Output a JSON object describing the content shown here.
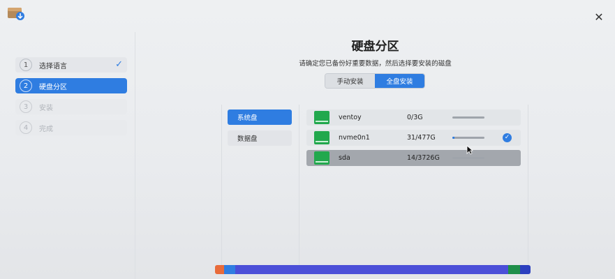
{
  "window": {
    "title": ""
  },
  "steps": [
    {
      "num": "1",
      "label": "选择语言",
      "state": "done"
    },
    {
      "num": "2",
      "label": "硬盘分区",
      "state": "active"
    },
    {
      "num": "3",
      "label": "安装",
      "state": "todo"
    },
    {
      "num": "4",
      "label": "完成",
      "state": "todo"
    }
  ],
  "main": {
    "title": "硬盘分区",
    "subtitle": "请确定您已备份好重要数据，然后选择要安装的磁盘",
    "mode_manual": "手动安装",
    "mode_full": "全盘安装",
    "selected_mode": "全盘安装"
  },
  "tabs": [
    {
      "label": "系统盘",
      "selected": true
    },
    {
      "label": "数据盘",
      "selected": false
    }
  ],
  "disks": [
    {
      "name": "ventoy",
      "size": "0/3G",
      "used_fraction": 0.0,
      "selected": false
    },
    {
      "name": "nvme0n1",
      "size": "31/477G",
      "used_fraction": 0.07,
      "selected": true
    },
    {
      "name": "sda",
      "size": "14/3726G",
      "used_fraction": 0.0,
      "selected": false
    }
  ],
  "partition_bar": {
    "colors": [
      "#e86b3a",
      "#2f7de1",
      "#4b4fd8",
      "#1f8f4a",
      "#2b3fbf"
    ]
  },
  "accent": "#2f7de1"
}
